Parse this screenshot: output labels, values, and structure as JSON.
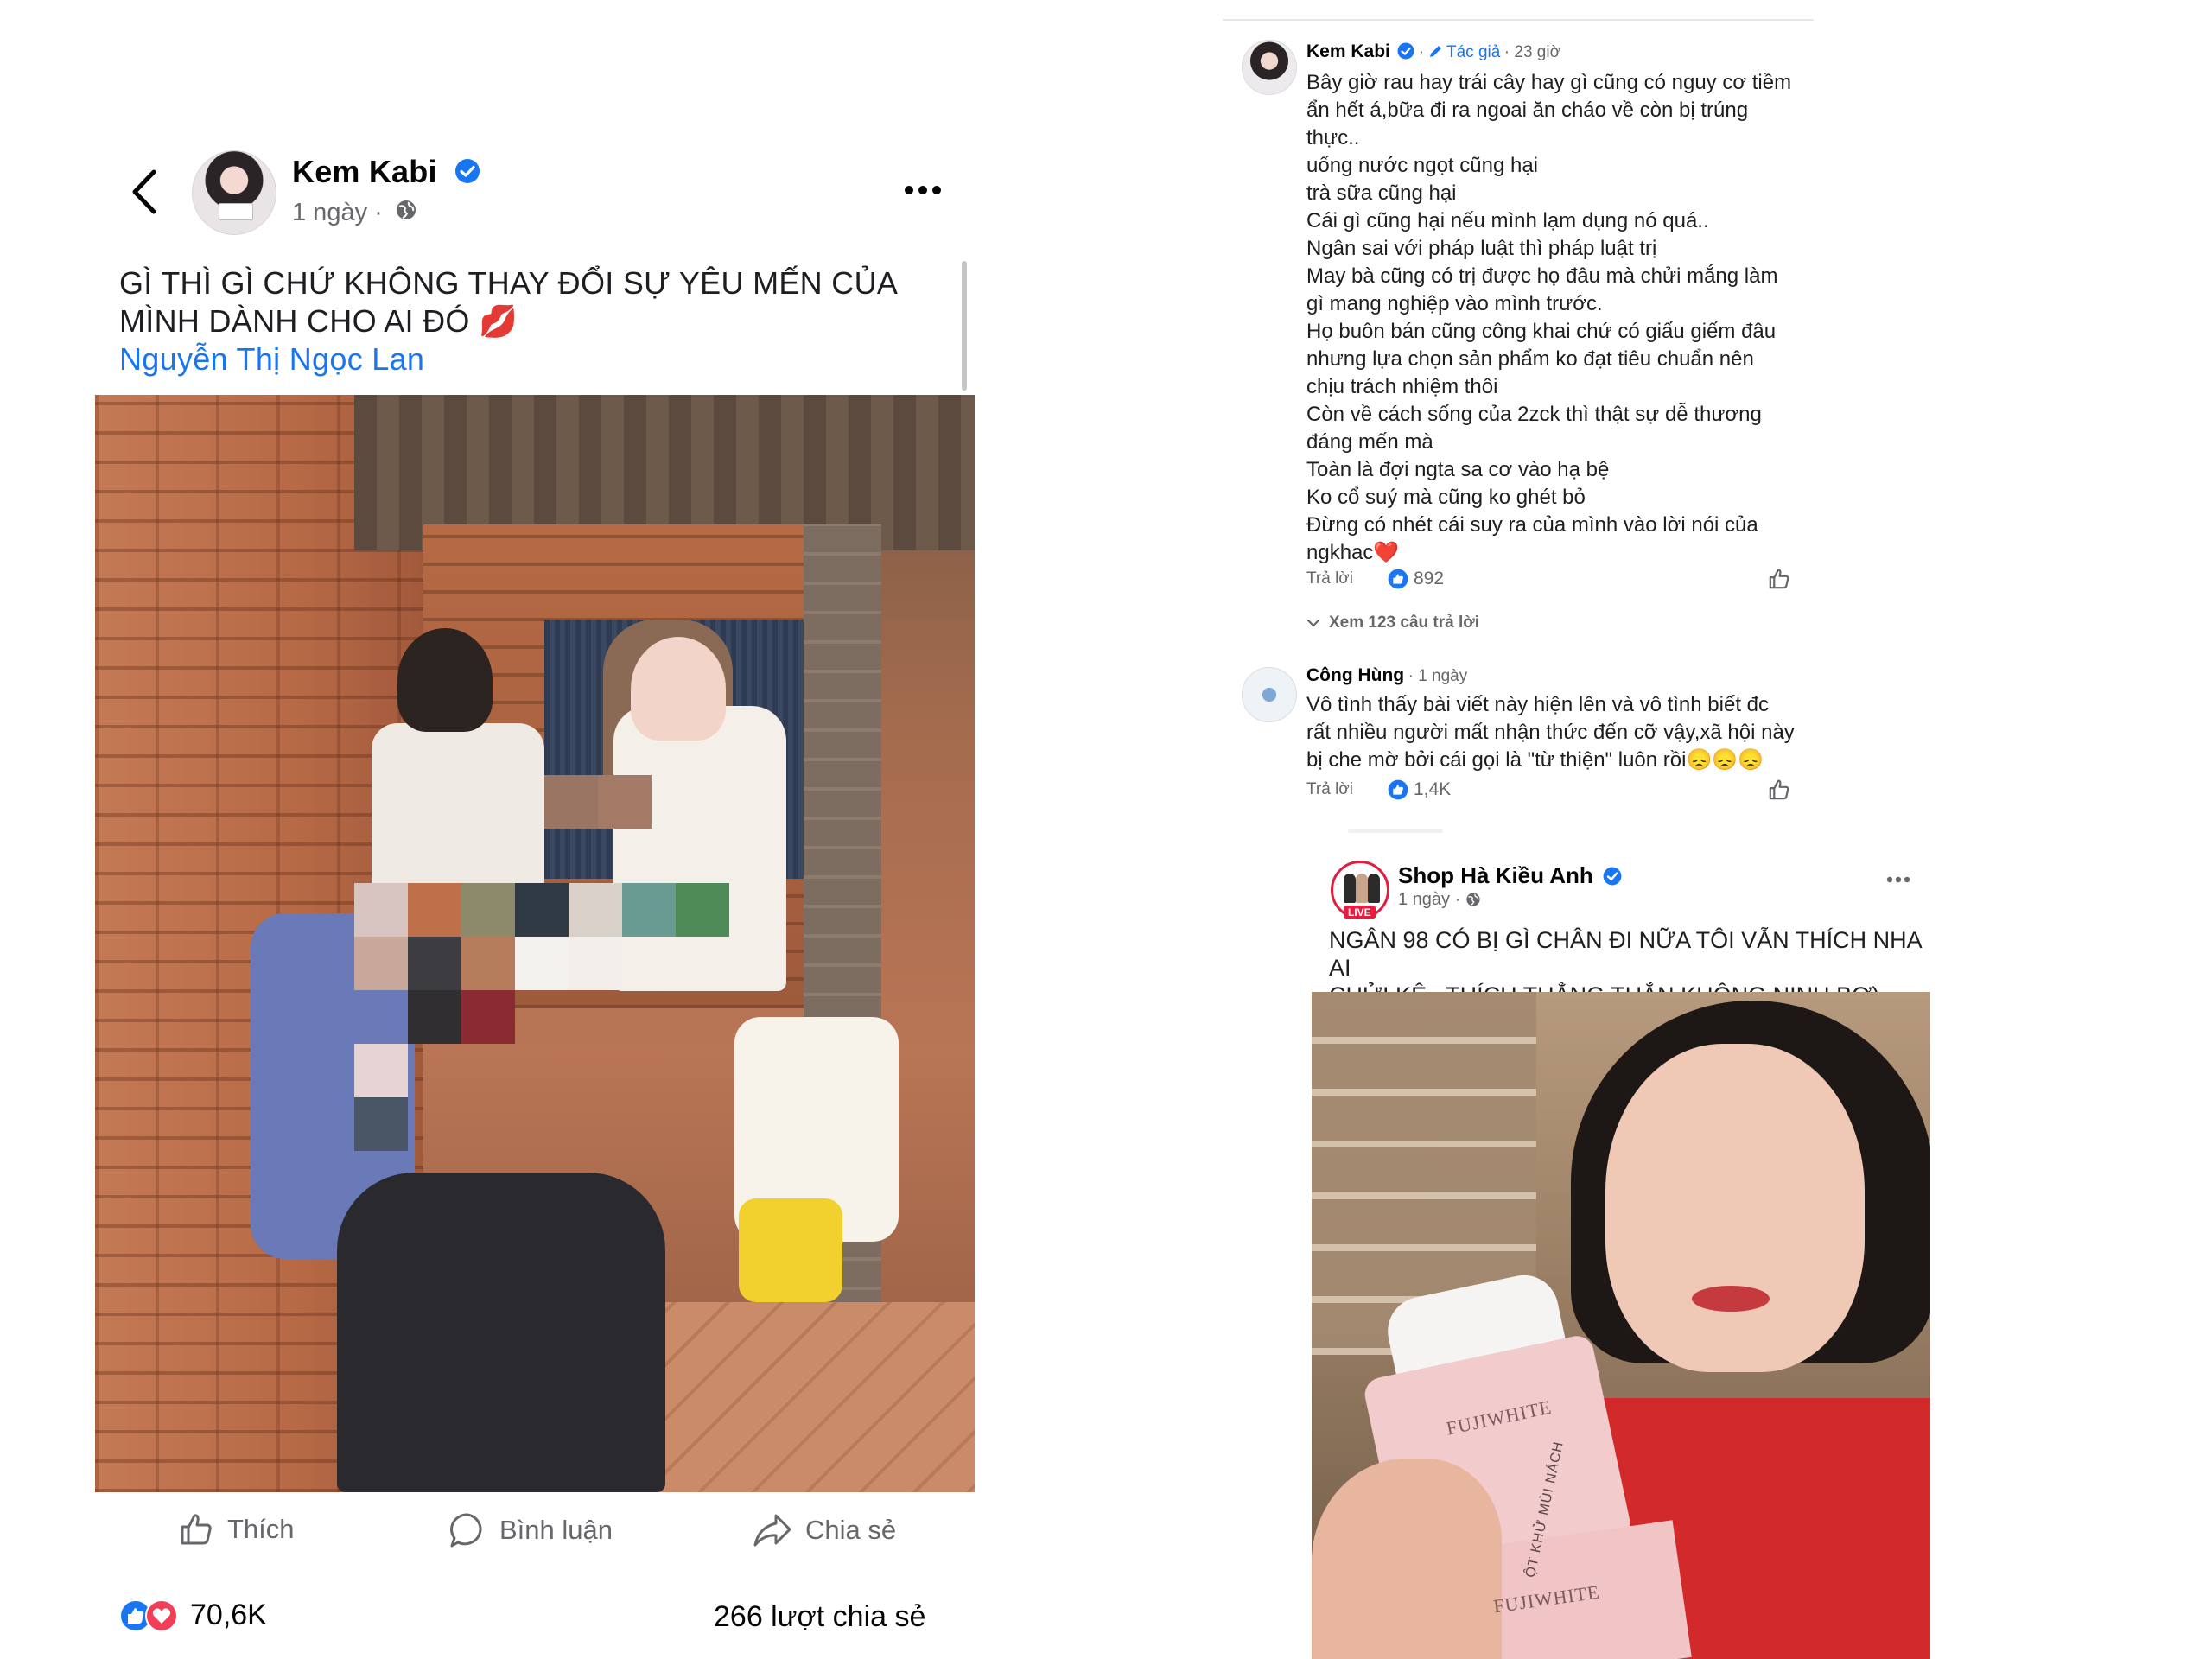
{
  "post": {
    "author": "Kem Kabi",
    "time": "1 ngày",
    "separator": "·",
    "text": "GÌ THÌ GÌ CHỨ KHÔNG THAY ĐỔI SỰ YÊU MẾN CỦA MÌNH DÀNH CHO AI ĐÓ 💋",
    "tag": "Nguyễn Thị Ngọc Lan",
    "actions": {
      "like": "Thích",
      "comment": "Bình luận",
      "share": "Chia sẻ"
    },
    "reaction_count": "70,6K",
    "share_count": "266 lượt chia sẻ"
  },
  "comments": [
    {
      "name": "Kem Kabi",
      "author_tag": "Tác giả",
      "meta": "· 23 giờ",
      "lines": [
        "Bây giờ rau hay trái cây hay gì cũng có nguy cơ tiềm",
        "ẩn hết á,bữa đi ra ngoai ăn cháo về còn bị trúng",
        "thực..",
        "uống nước ngọt cũng hại",
        "trà sữa cũng hại",
        "Cái gì cũng hại nếu mình lạm dụng nó quá..",
        "Ngân sai với pháp luật thì pháp luật trị",
        "May bà cũng có trị được họ đâu mà chửi mắng làm",
        "gì mang nghiệp vào mình trước.",
        "Họ buôn bán cũng công khai chứ có giấu giếm đâu",
        "nhưng lựa chọn sản phẩm ko đạt tiêu chuẩn nên",
        "chịu trách nhiệm thôi",
        "Còn về cách sống của 2zck thì thật sự dễ thương",
        "đáng mến mà",
        "Toàn là đợi ngta sa cơ vào hạ bệ",
        "Ko cổ suý mà cũng ko ghét bỏ",
        "Đừng có nhét cái suy ra của mình vào lời nói của",
        "ngkhac❤️"
      ],
      "reply_label": "Trả lời",
      "likes": "892",
      "view_replies": "Xem 123 câu trả lời"
    },
    {
      "name": "Công Hùng",
      "meta": "· 1 ngày",
      "lines": [
        "Vô tình thấy bài viết này hiện lên và vô tình biết đc",
        "rất nhiều người mất nhận thức đến cỡ vậy,xã hội này",
        "bị che mờ bởi cái gọi là \"từ thiện\" luôn rồi😞😞😞"
      ],
      "reply_label": "Trả lời",
      "likes": "1,4K"
    }
  ],
  "shop_post": {
    "name": "Shop Hà Kiều Anh",
    "live_badge": "LIVE",
    "time": "1 ngày",
    "separator": "·",
    "text_lines": [
      "NGÂN 98 CÓ BỊ GÌ CHÂN ĐI NỮA TÔI VẪN THÍCH NHA AI",
      "CHỬI KỆ . THÍCH THẲNG THẮN KHÔNG NỊNH BỢ)"
    ],
    "product_labels": [
      "FUJIWHITE",
      "ỘT KHỬ MÙI NÁCH",
      "FUJIWHITE"
    ]
  },
  "colors": {
    "accent": "#1876f2",
    "text": "#050505",
    "muted": "#65676b",
    "love": "#f33e58",
    "live": "#e41e3f"
  },
  "icons": [
    "back-chevron-icon",
    "verified-badge-icon",
    "globe-icon",
    "more-dots-icon",
    "thumbs-up-icon",
    "comment-bubble-icon",
    "share-arrow-icon",
    "like-reaction-icon",
    "love-reaction-icon",
    "pencil-icon",
    "chevron-down-icon"
  ]
}
